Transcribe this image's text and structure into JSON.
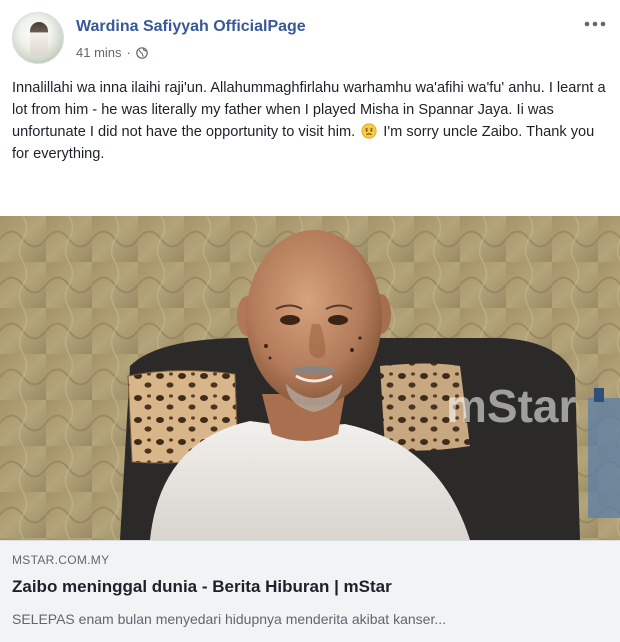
{
  "post": {
    "page_name": "Wardina Safiyyah OfficialPage",
    "time": "41 mins",
    "separator": "·",
    "privacy_icon": "globe-icon",
    "more_icon": "more-options-icon",
    "text_part1": "Innalillahi wa inna ilaihi raji'un. Allahummaghfirlahu warhamhu wa'afihi wa'fu' anhu. I learnt a lot from him - he was literally my father when I played Misha in Spannar Jaya. Ii was unfortunate I did not have the opportunity to visit him.",
    "emoji": "sad-face-emoji",
    "text_part2": "I'm sorry uncle Zaibo. Thank you for everything."
  },
  "photo": {
    "watermark": "mStar"
  },
  "link": {
    "domain": "MSTAR.COM.MY",
    "title": "Zaibo meninggal dunia - Berita Hiburan | mStar",
    "description": "SELEPAS enam bulan menyedari hidupnya menderita akibat kanser..."
  },
  "colors": {
    "link_blue": "#385898",
    "meta_gray": "#616770",
    "card_bg": "#f2f3f5"
  }
}
